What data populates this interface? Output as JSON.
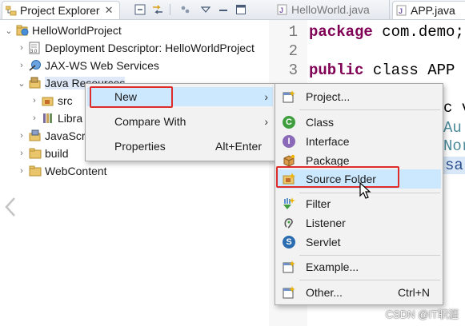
{
  "left_tab": {
    "title": "Project Explorer"
  },
  "tree": {
    "root": "HelloWorldProject",
    "items": [
      {
        "label": "Deployment Descriptor: HelloWorldProject"
      },
      {
        "label": "JAX-WS Web Services"
      },
      {
        "label": "Java Resources"
      },
      {
        "label": "src"
      },
      {
        "label": "Libra"
      },
      {
        "label": "JavaScr"
      },
      {
        "label": "build"
      },
      {
        "label": "WebContent"
      }
    ]
  },
  "editor": {
    "tabs": [
      {
        "label": "HelloWorld.java"
      },
      {
        "label": "APP.java"
      }
    ],
    "line_numbers": [
      "1",
      "2",
      "3"
    ],
    "lines": {
      "l1_keyword": "package",
      "l1_rest": " com.demo;",
      "l3_keyword": "public",
      "l3_rest": " class APP {"
    },
    "partial": {
      "a": "c v",
      "b": "Au",
      "c": "Nor",
      "d": "sa"
    }
  },
  "context_menu": {
    "items": [
      {
        "label": "New"
      },
      {
        "label": "Compare With"
      },
      {
        "label": "Properties",
        "shortcut": "Alt+Enter"
      }
    ]
  },
  "submenu": {
    "items": [
      {
        "label": "Project..."
      },
      {
        "label": "Class"
      },
      {
        "label": "Interface"
      },
      {
        "label": "Package"
      },
      {
        "label": "Source Folder"
      },
      {
        "label": "Filter"
      },
      {
        "label": "Listener"
      },
      {
        "label": "Servlet"
      },
      {
        "label": "Example..."
      },
      {
        "label": "Other...",
        "shortcut": "Ctrl+N"
      }
    ]
  },
  "watermark": "CSDN @IT职涯",
  "colors": {
    "highlight": "#cce8ff",
    "annotation_red": "#e02b2b",
    "keyword": "#7f0055"
  }
}
